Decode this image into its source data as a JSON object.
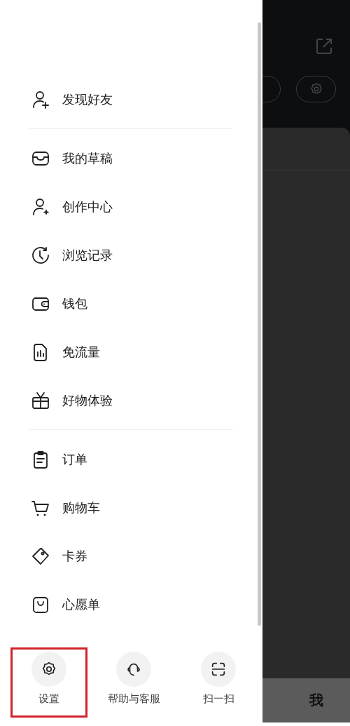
{
  "drawer": {
    "sections": [
      {
        "items": [
          {
            "label": "发现好友"
          }
        ]
      },
      {
        "items": [
          {
            "label": "我的草稿"
          },
          {
            "label": "创作中心"
          },
          {
            "label": "浏览记录"
          },
          {
            "label": "钱包"
          },
          {
            "label": "免流量"
          },
          {
            "label": "好物体验"
          }
        ]
      },
      {
        "items": [
          {
            "label": "订单"
          },
          {
            "label": "购物车"
          },
          {
            "label": "卡券"
          },
          {
            "label": "心愿单"
          }
        ]
      }
    ],
    "bottom_actions": [
      {
        "label": "设置",
        "highlighted": true
      },
      {
        "label": "帮助与客服",
        "highlighted": false
      },
      {
        "label": "扫一扫",
        "highlighted": false
      }
    ]
  },
  "background": {
    "tab_bar": {
      "label": "我"
    }
  }
}
